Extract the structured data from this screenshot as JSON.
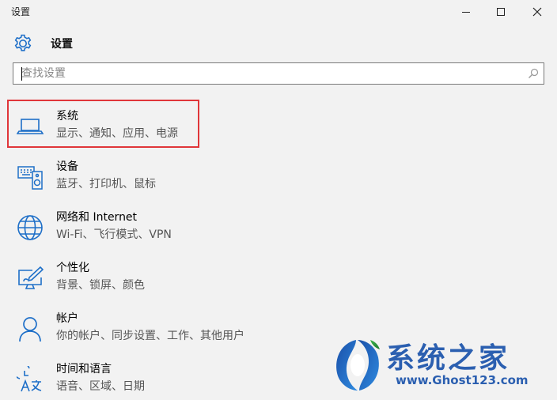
{
  "window": {
    "title": "设置",
    "minimize_icon": "minimize-icon",
    "maximize_icon": "maximize-icon",
    "close_icon": "close-icon"
  },
  "header": {
    "icon": "gear-icon",
    "title": "设置"
  },
  "search": {
    "placeholder": "查找设置",
    "value": "",
    "icon": "search-icon"
  },
  "categories": [
    {
      "icon": "laptop-icon",
      "name": "系统",
      "desc": "显示、通知、应用、电源",
      "selected": true
    },
    {
      "icon": "keyboard-speaker-icon",
      "name": "设备",
      "desc": "蓝牙、打印机、鼠标"
    },
    {
      "icon": "globe-icon",
      "name": "网络和 Internet",
      "desc": "Wi-Fi、飞行模式、VPN"
    },
    {
      "icon": "personalization-icon",
      "name": "个性化",
      "desc": "背景、锁屏、颜色"
    },
    {
      "icon": "person-icon",
      "name": "帐户",
      "desc": "你的帐户、同步设置、工作、其他用户"
    },
    {
      "icon": "time-language-icon",
      "name": "时间和语言",
      "desc": "语音、区域、日期"
    }
  ],
  "colors": {
    "accent": "#1e6fc8",
    "highlight_border": "#e0363a",
    "watermark": "#2b5fb0"
  },
  "watermark": {
    "title": "系统之家",
    "url": "www.Ghost123.com"
  }
}
